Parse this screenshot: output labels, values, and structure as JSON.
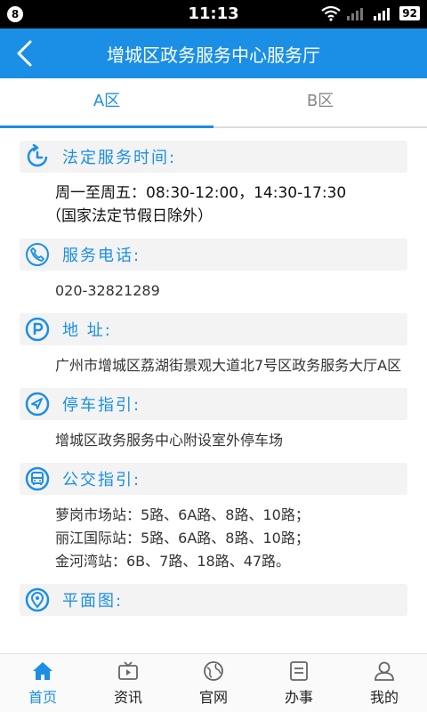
{
  "status_bar": {
    "badge": "8",
    "time": "11:13",
    "battery": "92"
  },
  "header": {
    "title": "增城区政务服务中心服务厅"
  },
  "tabs": [
    {
      "label": "A区",
      "active": true
    },
    {
      "label": "B区",
      "active": false
    }
  ],
  "sections": {
    "hours": {
      "label": "法定服务时间:",
      "line1": "周一至周五：08:30-12:00，14:30-17:30",
      "line2": "（国家法定节假日除外）"
    },
    "phone": {
      "label": "服务电话:",
      "value": "020-32821289"
    },
    "address": {
      "label": "地 址:",
      "value": "广州市增城区荔湖街景观大道北7号区政务服务大厅A区"
    },
    "parking": {
      "label": "停车指引:",
      "value": "增城区政务服务中心附设室外停车场"
    },
    "bus": {
      "label": "公交指引:",
      "lines": [
        "萝岗市场站：5路、6A路、8路、10路；",
        "丽江国际站：5路、6A路、8路、10路；",
        "金河湾站：6B、7路、18路、47路。"
      ]
    },
    "map": {
      "label": "平面图:"
    }
  },
  "nav": [
    {
      "label": "首页",
      "icon": "home-icon",
      "active": true
    },
    {
      "label": "资讯",
      "icon": "tv-icon",
      "active": false
    },
    {
      "label": "官网",
      "icon": "globe-icon",
      "active": false
    },
    {
      "label": "办事",
      "icon": "document-icon",
      "active": false
    },
    {
      "label": "我的",
      "icon": "user-icon",
      "active": false
    }
  ],
  "colors": {
    "accent": "#1b8fe6",
    "status_bar": "#000000"
  }
}
